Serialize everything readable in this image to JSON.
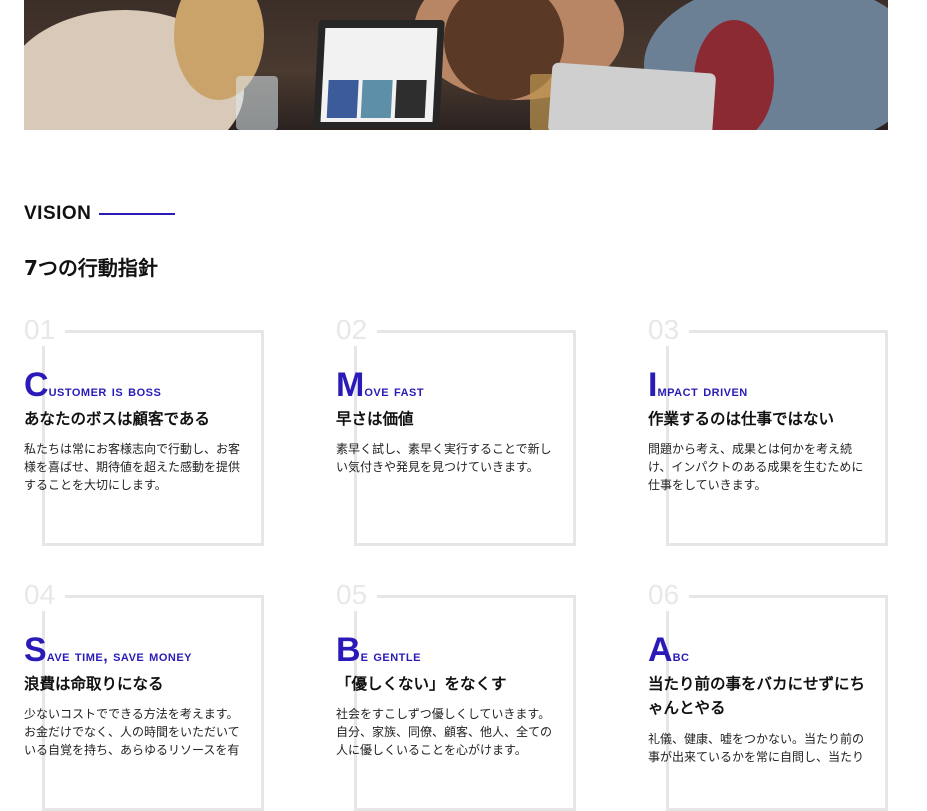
{
  "vision": {
    "label": "VISION",
    "title": "7つの行動指針",
    "accent_color": "#2a1ab8"
  },
  "cards": [
    {
      "num": "01",
      "initial": "C",
      "rest": "ustomer is boss",
      "subtitle": "あなたのボスは顧客である",
      "desc": "私たちは常にお客様志向で行動し、お客様を喜ばせ、期待値を超えた感動を提供することを大切にします。"
    },
    {
      "num": "02",
      "initial": "M",
      "rest": "ove fast",
      "subtitle": "早さは価値",
      "desc": "素早く試し、素早く実行することで新しい気付きや発見を見つけていきます。"
    },
    {
      "num": "03",
      "initial": "I",
      "rest": "mpact driven",
      "subtitle": "作業するのは仕事ではない",
      "desc": "問題から考え、成果とは何かを考え続け、インパクトのある成果を生むために仕事をしていきます。"
    },
    {
      "num": "04",
      "initial": "S",
      "rest": "ave time, save money",
      "subtitle": "浪費は命取りになる",
      "desc": "少ないコストでできる方法を考えます。お金だけでなく、人の時間をいただいている自覚を持ち、あらゆるリソースを有"
    },
    {
      "num": "05",
      "initial": "B",
      "rest": "e gentle",
      "subtitle": "「優しくない」をなくす",
      "desc": "社会をすこしずつ優しくしていきます。自分、家族、同僚、顧客、他人、全ての人に優しくいることを心がけます。"
    },
    {
      "num": "06",
      "initial": "A",
      "rest": "bc",
      "subtitle": "当たり前の事をバカにせずにちゃんとやる",
      "desc": "礼儀、健康、嘘をつかない。当たり前の事が出来ているかを常に自問し、当たり"
    }
  ]
}
